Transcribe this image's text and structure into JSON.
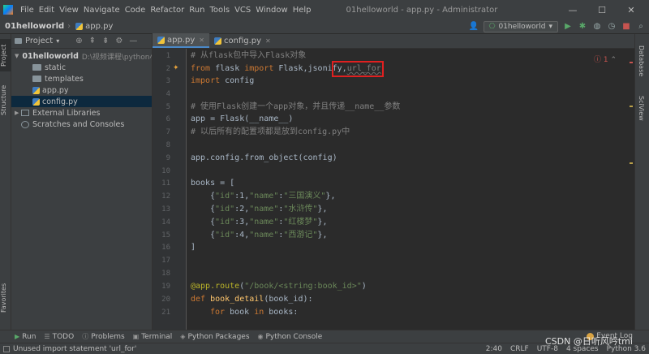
{
  "menubar": {
    "items": [
      "File",
      "Edit",
      "View",
      "Navigate",
      "Code",
      "Refactor",
      "Run",
      "Tools",
      "VCS",
      "Window",
      "Help"
    ],
    "window_title": "01helloworld - app.py - Administrator"
  },
  "navbar": {
    "project": "01helloworld",
    "file": "app.py",
    "run_config": "01helloworld"
  },
  "left_stripe": {
    "project_tab": "Project",
    "structure_tab": "Structure",
    "favorites_tab": "Favorites"
  },
  "right_stripe": {
    "database_tab": "Database",
    "sciview_tab": "SciView"
  },
  "project_panel": {
    "title": "Project",
    "root": {
      "name": "01helloworld",
      "path": "D:\\视频课程\\python小"
    },
    "children": [
      "static",
      "templates",
      "app.py",
      "config.py"
    ],
    "external_libraries": "External Libraries",
    "scratches": "Scratches and Consoles"
  },
  "editor": {
    "tabs": [
      {
        "label": "app.py",
        "active": true
      },
      {
        "label": "config.py",
        "active": false
      }
    ],
    "line_numbers": [
      "1",
      "2",
      "3",
      "4",
      "5",
      "6",
      "7",
      "8",
      "9",
      "10",
      "11",
      "12",
      "13",
      "14",
      "15",
      "16",
      "17",
      "18",
      "19",
      "20",
      "21"
    ],
    "code": {
      "l1": "# 从flask包中导入Flask对象",
      "l2_from": "from",
      "l2_mod": " flask ",
      "l2_import": "import",
      "l2_names": " Flask,jsonify,",
      "l2_unused": "url_for",
      "l3_import": "import",
      "l3_mod": " config",
      "l5": "# 使用Flask创建一个app对象，并且传递__name__参数",
      "l6": "app = Flask(__name__)",
      "l7": "# 以后所有的配置项都是放到config.py中",
      "l9": "app.config.from_object(config)",
      "l11": "books = [",
      "books": [
        {
          "id_key": "\"id\"",
          "id": "1",
          "name_key": "\"name\"",
          "name": "\"三国演义\""
        },
        {
          "id_key": "\"id\"",
          "id": "2",
          "name_key": "\"name\"",
          "name": "\"水浒传\""
        },
        {
          "id_key": "\"id\"",
          "id": "3",
          "name_key": "\"name\"",
          "name": "\"红楼梦\""
        },
        {
          "id_key": "\"id\"",
          "id": "4",
          "name_key": "\"name\"",
          "name": "\"西游记\""
        }
      ],
      "l16": "]",
      "l19_dec": "@app.route",
      "l19_arg": "\"/book/<string:book_id>\"",
      "l20_def": "def",
      "l20_fn": " book_detail",
      "l20_args": "(book_id):",
      "l21_for": "for",
      "l21_mid": " book ",
      "l21_in": "in",
      "l21_rest": " books:"
    },
    "error_count": "1",
    "accent_color": "#4a88c7",
    "highlight_color": "#e02020"
  },
  "bottom_tools": {
    "run": "Run",
    "todo": "TODO",
    "problems": "Problems",
    "terminal": "Terminal",
    "python_packages": "Python Packages",
    "python_console": "Python Console",
    "event_log": "Event Log"
  },
  "statusbar": {
    "message": "Unused import statement 'url_for'",
    "position": "2:40",
    "line_sep": "CRLF",
    "encoding": "UTF-8",
    "indent": "4 spaces",
    "interpreter": "Python 3.6"
  },
  "watermark": "CSDN @日听风吟tmi"
}
